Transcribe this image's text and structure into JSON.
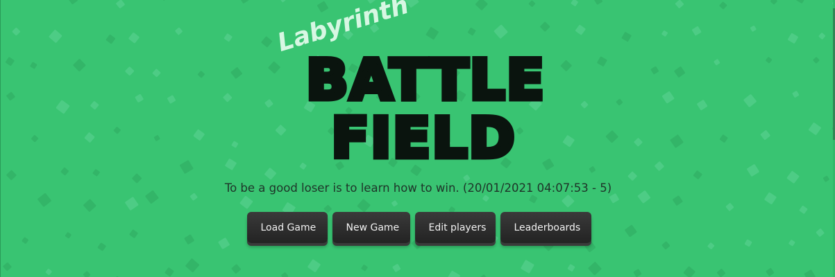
{
  "logo": {
    "subtitle": "Labyrinth",
    "line1": "BATTLE",
    "line2": "FIELD"
  },
  "quote": "To be a good loser is to learn how to win. (20/01/2021 04:07:53 - 5)",
  "menu": {
    "load_game": "Load Game",
    "new_game": "New Game",
    "edit_players": "Edit players",
    "leaderboards": "Leaderboards"
  },
  "colors": {
    "background": "#39c472",
    "logo": "#0a140e",
    "subtitle": "#d7f7e3",
    "button": "#2a2a2a",
    "button_text": "#f2f2f2"
  }
}
